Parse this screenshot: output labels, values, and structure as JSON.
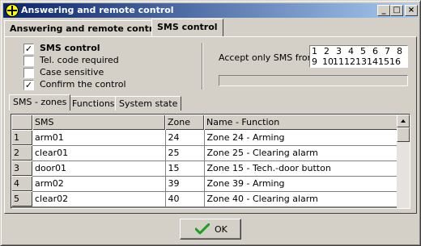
{
  "window": {
    "title": "Answering and remote control",
    "controls": {
      "minimize": "_",
      "maximize": "□",
      "close": "×"
    }
  },
  "top_tabs": [
    {
      "label": "Answering and remote control",
      "active": false
    },
    {
      "label": "SMS control",
      "active": true
    }
  ],
  "options": [
    {
      "label": "SMS control",
      "checked": true,
      "bold": true
    },
    {
      "label": "Tel. code required",
      "checked": false,
      "bold": false
    },
    {
      "label": "Case sensitive",
      "checked": false,
      "bold": false
    },
    {
      "label": "Confirm the control",
      "checked": true,
      "bold": false
    }
  ],
  "accept_sms": {
    "label": "Accept only SMS from:",
    "numbers": [
      "1",
      "2",
      "3",
      "4",
      "5",
      "6",
      "7",
      "8",
      "9",
      "10",
      "11",
      "12",
      "13",
      "14",
      "15",
      "16"
    ]
  },
  "inner_tabs": [
    {
      "label": "SMS - zones",
      "active": true
    },
    {
      "label": "Functions",
      "active": false
    },
    {
      "label": "System state",
      "active": false
    }
  ],
  "grid": {
    "columns": [
      "",
      "SMS",
      "Zone",
      "Name - Function"
    ],
    "rows": [
      {
        "num": "1",
        "sms": "arm01",
        "zone": "24",
        "name": "Zone 24 - Arming"
      },
      {
        "num": "2",
        "sms": "clear01",
        "zone": "25",
        "name": "Zone 25 - Clearing alarm"
      },
      {
        "num": "3",
        "sms": "door01",
        "zone": "15",
        "name": "Zone 15 - Tech.-door button"
      },
      {
        "num": "4",
        "sms": "arm02",
        "zone": "39",
        "name": "Zone 39 - Arming"
      },
      {
        "num": "5",
        "sms": "clear02",
        "zone": "40",
        "name": "Zone 40 - Clearing alarm"
      }
    ]
  },
  "ok_button": {
    "label": "OK"
  },
  "colors": {
    "titlebar_start": "#0a246a",
    "titlebar_end": "#a6caf0",
    "ok_check": "#1e9e1e"
  }
}
